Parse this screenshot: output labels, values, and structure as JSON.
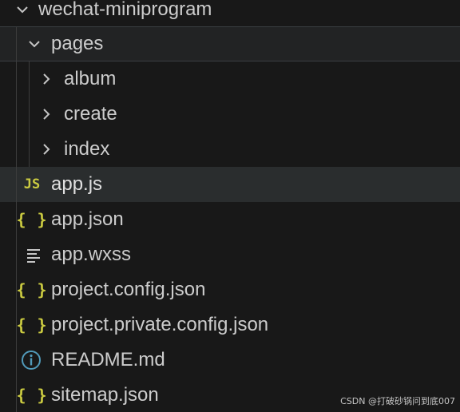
{
  "tree": {
    "root_folder": "wechat-miniprogram",
    "pages_folder": "pages",
    "subfolders": [
      "album",
      "create",
      "index"
    ],
    "files": [
      {
        "name": "app.js",
        "icon": "js-icon"
      },
      {
        "name": "app.json",
        "icon": "json-braces-icon"
      },
      {
        "name": "app.wxss",
        "icon": "lines-icon"
      },
      {
        "name": "project.config.json",
        "icon": "json-braces-icon"
      },
      {
        "name": "project.private.config.json",
        "icon": "json-braces-icon"
      },
      {
        "name": "README.md",
        "icon": "info-icon"
      },
      {
        "name": "sitemap.json",
        "icon": "json-braces-icon"
      }
    ]
  },
  "icons": {
    "js_text": "JS",
    "json_text": "{ }"
  },
  "colors": {
    "background": "#181818",
    "text": "#cccccc",
    "selected_row": "#2a2d2e",
    "js_json_icon": "#cbcb41",
    "info_icon": "#519aba"
  },
  "watermark": "CSDN @打破砂锅问到底007"
}
